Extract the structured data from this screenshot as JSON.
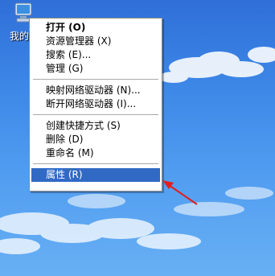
{
  "desktop": {
    "icon_label": "我的",
    "icon": "my-computer-icon"
  },
  "context_menu": {
    "items": [
      {
        "label": "打开 (O)",
        "bold": true
      },
      {
        "label": "资源管理器 (X)"
      },
      {
        "label": "搜索 (E)..."
      },
      {
        "label": "管理 (G)"
      },
      {
        "label": "映射网络驱动器 (N)..."
      },
      {
        "label": "断开网络驱动器 (I)..."
      },
      {
        "label": "创建快捷方式 (S)"
      },
      {
        "label": "删除 (D)"
      },
      {
        "label": "重命名 (M)"
      },
      {
        "label": "属性 (R)",
        "selected": true
      }
    ]
  },
  "colors": {
    "selection": "#316ac5",
    "arrow": "#e02020",
    "sky": "#3c86e6"
  }
}
